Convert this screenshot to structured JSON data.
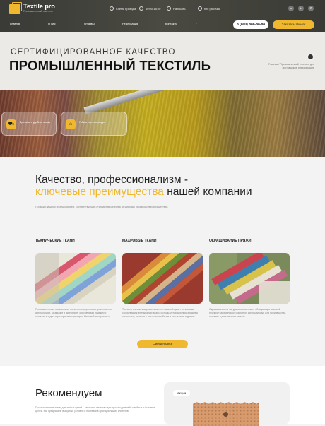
{
  "header": {
    "brand": "Textile pro",
    "brand_sub": "Промышленный текстиль",
    "info": [
      {
        "icon": "document-icon",
        "text": "Схема проезда"
      },
      {
        "icon": "clock-icon",
        "text": "10:00-18:00"
      },
      {
        "icon": "mail-icon",
        "text": "Написать"
      },
      {
        "icon": "phone-icon",
        "text": "Кто рабочий"
      }
    ],
    "social": [
      "vk-icon",
      "telegram-icon",
      "whatsapp-icon"
    ],
    "nav": [
      "Главная",
      "О нас",
      "Отзывы",
      "Реализация",
      "Контакты",
      "⋮"
    ],
    "phone": "8 (800) 888-88-88",
    "call_label": "Заказать звонок"
  },
  "hero": {
    "subtitle": "СЕРТИФИЦИРОВАННОЕ КАЧЕСТВО",
    "title": "ПРОМЫШЛЕННЫЙ ТЕКСТИЛЬ",
    "breadcrumb": "Главная / Промышленный текстиль для поставщиков и производств",
    "features": [
      {
        "icon": "truck-icon",
        "text": "Доставка в удобное время"
      },
      {
        "icon": "box-icon",
        "text": "Гибкая система скидок"
      }
    ]
  },
  "intro": {
    "title_line1": "Качество, профессионализм -",
    "title_accent": "ключевые преимущества",
    "title_rest": " нашей компании",
    "text": "Продажи нашими оборудованием, соответствующих стандартам качества на мировых производствах и обществах."
  },
  "categories": [
    {
      "title": "ТЕХНИЧЕСКИЕ ТКАНИ",
      "text": "Промышленные технические ткани используются в строительстве, автомобилях, медицине и экономике, обеспечивая надежную прочность и долгосрочную эксплуатацию. Широкий ассортимент."
    },
    {
      "title": "МАХРОВЫЕ ТКАНИ",
      "text": "Ткань со специализированными петлями обладает отличными свойствами к впитыванию влаги. Используется для производства полотенец, халатов и постельного белья в гостиницах и домах."
    },
    {
      "title": "ОКРАШИВАНИЕ ПРЯЖИ",
      "text": "Окрашивание из натуральных волокон, обладающих высокой прочностью и износостойкостью, используемые для производства прочных и долговечных тканей."
    }
  ],
  "more_label": "Смотреть все",
  "recommend": {
    "title": "Рекомендуем",
    "text": "Промышленные ткани для любых целей — высокое качество для производителей, швейных и бытовых целей. Мы предлагаем выгодные условия и поставки в срок для наших клиентов.",
    "badge": "Акции"
  },
  "colors": {
    "accent": "#f0b82e",
    "header_bg": "#3f3f3a"
  }
}
